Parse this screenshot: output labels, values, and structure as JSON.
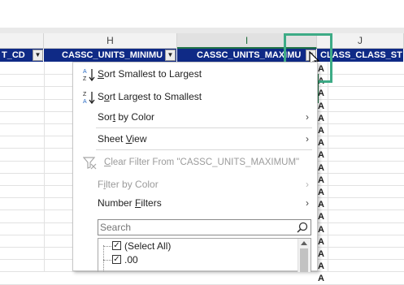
{
  "columns": {
    "h": "H",
    "i": "I",
    "j": "J"
  },
  "header_row": {
    "g_tail": "T_CD",
    "h": "CASSC_UNITS_MINIMU",
    "i": "CASSC_UNITS_MAXIMU",
    "j": "CLASS_CLASS_ST"
  },
  "column_j_values": [
    "A",
    "A",
    "A",
    "A",
    "A",
    "A",
    "A",
    "A",
    "A",
    "A",
    "A",
    "A",
    "A",
    "A",
    "A",
    "A",
    "A",
    "A"
  ],
  "menu": {
    "sort_asc": "Sort Smallest to Largest",
    "sort_desc": "Sort Largest to Smallest",
    "sort_by_color": "Sort by Color",
    "sheet_view": "Sheet View",
    "clear_filter": "Clear Filter From \"CASSC_UNITS_MAXIMUM\"",
    "filter_by_color": "Filter by Color",
    "number_filters": "Number Filters",
    "search_placeholder": "Search",
    "list_items": [
      {
        "label": "(Select All)",
        "checked": true
      },
      {
        "label": ".00",
        "checked": true
      }
    ]
  },
  "colors": {
    "header_fill": "#0f2a86",
    "selection_green": "#3dab86",
    "excel_green": "#217346"
  },
  "icons": {
    "sort_asc": "sort-ascending-icon",
    "sort_desc": "sort-descending-icon",
    "clear_filter": "clear-filter-icon",
    "search": "search-icon",
    "dropdown": "filter-dropdown-icon",
    "cursor": "mouse-cursor-icon"
  }
}
